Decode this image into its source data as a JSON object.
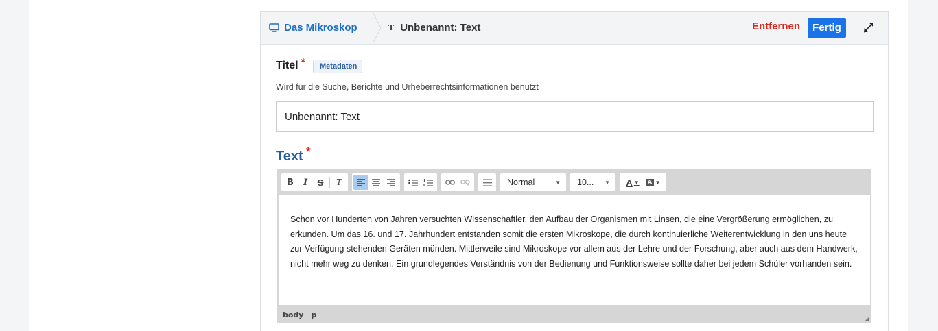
{
  "breadcrumb": {
    "root_label": "Das Mikroskop",
    "current_icon": "T",
    "current_label": "Unbenannt: Text"
  },
  "actions": {
    "remove_label": "Entfernen",
    "done_label": "Fertig"
  },
  "form": {
    "title_label": "Titel",
    "required_mark": "*",
    "metadata_tag": "Metadaten",
    "title_description": "Wird für die Suche, Berichte und Urheberrechtsinformationen benutzt",
    "title_value": "Unbenannt: Text",
    "text_label": "Text"
  },
  "toolbar": {
    "bold": "B",
    "italic": "I",
    "strike": "S",
    "clear": "T",
    "format_value": "Normal",
    "size_value": "10...",
    "font_color": "A",
    "bg_color": "A"
  },
  "editor": {
    "content": "Schon vor Hunderten von Jahren versuchten Wissenschaftler, den Aufbau der Organismen mit Linsen, die eine Vergrößerung ermöglichen, zu erkunden. Um das 16. und 17. Jahrhundert entstanden somit die ersten Mikroskope, die durch kontinuierliche Weiterentwicklung in den uns heute zur Verfügung stehenden Geräten münden. Mittlerweile sind Mikroskope vor allem aus der Lehre und der Forschung, aber auch aus dem Handwerk, nicht mehr weg zu denken. Ein grundlegendes Verständnis von der Bedienung und Funktionsweise sollte daher bei jedem Schüler vorhanden sein.",
    "path": [
      "body",
      "p"
    ]
  },
  "icons": {
    "root": "monitor-icon",
    "expand": "expand-icon"
  },
  "colors": {
    "accent_blue": "#1a73e8",
    "link_blue": "#1f6fc5",
    "danger_red": "#d8271c",
    "heading_blue": "#2a5d9c",
    "active_button": "#a8cbee"
  }
}
